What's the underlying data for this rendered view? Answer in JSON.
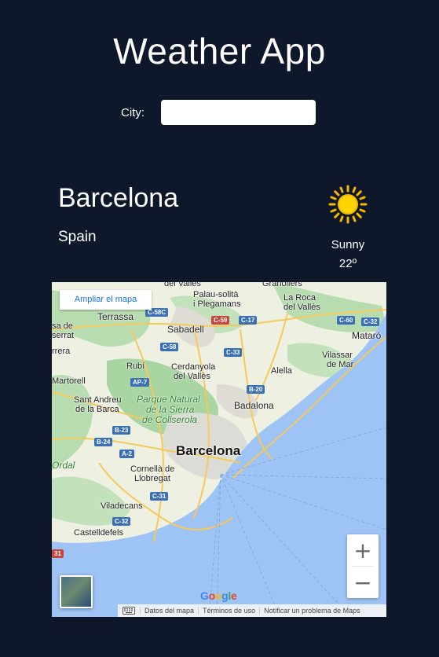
{
  "app": {
    "title": "Weather App"
  },
  "search": {
    "label": "City:",
    "value": "",
    "placeholder": ""
  },
  "weather": {
    "city": "Barcelona",
    "country": "Spain",
    "condition": "Sunny",
    "temperature": "22º",
    "icon": "sun-icon"
  },
  "map": {
    "enlarge_label": "Ampliar el mapa",
    "zoom_in": "+",
    "zoom_out": "−",
    "google": "Google",
    "attribution": {
      "map_data": "Datos del mapa",
      "terms": "Términos de uso",
      "report": "Notificar un problema de Maps"
    },
    "labels": {
      "granollers": "Granollers",
      "palau": "Palau-solità",
      "plegamans": "i Plegamans",
      "laroca": "La Roca",
      "delvalles": "del Vallès",
      "terrassa": "Terrassa",
      "sabadell": "Sabadell",
      "mataro": "Mataró",
      "sa_de": "sa de",
      "serrat": "serrat",
      "rrera": "rrera",
      "rubi": "Rubí",
      "cerdanyola": "Cerdanyola",
      "cerdanyola2": "del Vallès",
      "alella": "Alella",
      "vilassar": "Vilassar",
      "demar": "de Mar",
      "martorell": "Martorell",
      "santandreu": "Sant Andreu",
      "delabarca": "de la Barca",
      "parque1": "Parque Natural",
      "parque2": "de la Sierra",
      "parque3": "de Collserola",
      "badalona": "Badalona",
      "barcelona": "Barcelona",
      "ordal": "Ordal",
      "cornella": "Cornellà de",
      "llobregat": "Llobregat",
      "viladecans": "Viladecans",
      "castelldefels": "Castelldefels"
    },
    "roads": {
      "c58c": "C-58C",
      "c59": "C-59",
      "c17": "C-17",
      "c60": "C-60",
      "c32a": "C-32",
      "c58": "C-58",
      "c33": "C-33",
      "ap7": "AP-7",
      "b20": "B-20",
      "b23": "B-23",
      "b24": "B-24",
      "a2": "A-2",
      "c31": "C-31",
      "c32b": "C-32",
      "c31b": "31"
    }
  },
  "colors": {
    "background": "#0f172a",
    "text": "#ffffff",
    "sun": "#f5c518",
    "sea": "#9ec3f5",
    "land": "#e8ecd9",
    "park": "#a8d5a2",
    "urban": "#dcdcd8"
  }
}
